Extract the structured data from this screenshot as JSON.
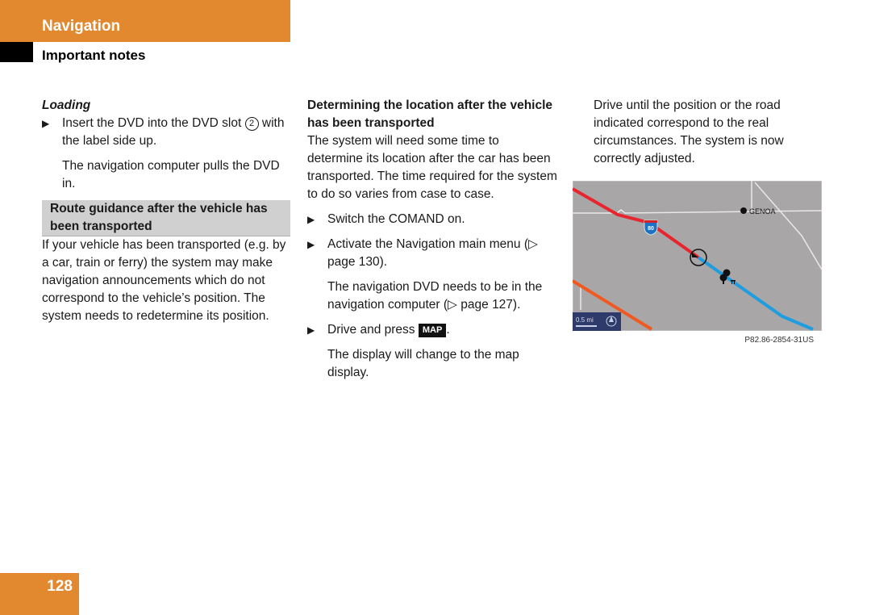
{
  "header": {
    "section": "Navigation",
    "subsection": "Important notes"
  },
  "column1": {
    "heading": "Loading",
    "bullet1": "Insert the DVD into the DVD slot",
    "bullet1_ref": "2",
    "bullet1_end": "with the label side up.",
    "result1": "The navigation computer pulls the DVD in.",
    "box_heading": "Route guidance after the vehicle has been transported",
    "body": "If your vehicle has been transported (e.g. by a car, train or ferry) the system may make navigation announcements which do not correspond to the vehicle’s position. The system needs to redetermine its position."
  },
  "column2": {
    "heading": "Determining the location after the vehicle has been transported",
    "intro": "The system will need some time to determine its location after the car has been transported. The time required for the system to do so varies from case to case.",
    "step1": "Switch the COMAND on.",
    "step2": "Activate the Navigation main menu (▷ page 130).",
    "step2_result": "The navigation DVD needs to be in the navigation computer (▷ page 127).",
    "step3_pre": "Drive and press",
    "step3_key": "MAP",
    "step3_post": ".",
    "step3_result": "The display will change to the map display."
  },
  "column3": {
    "body": "Drive until the position or the road indicated correspond to the real circumstances. The system is now correctly adjusted.",
    "map": {
      "city_label": "GENOA",
      "highway_shield": "80",
      "scale": "0.5 mi",
      "compass": "N",
      "colors": {
        "background": "#a8a6a6",
        "route_traveled": "#e8252f",
        "route_ahead": "#1e9de0",
        "other_road": "#f05a22",
        "scale_panel": "#2e3a6a"
      }
    },
    "caption": "P82.86-2854-31US"
  },
  "footer": {
    "page_number": "128"
  },
  "colors": {
    "accent": "#e2892f",
    "box_gray": "#d0d0d0"
  }
}
